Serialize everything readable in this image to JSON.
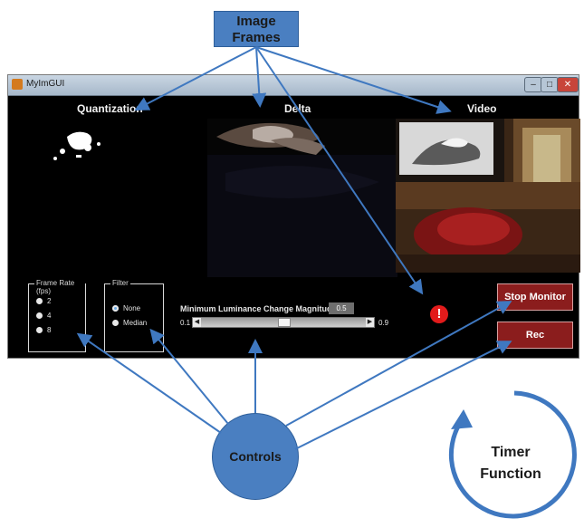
{
  "callout_image_frames": [
    "Image",
    "Frames"
  ],
  "callout_controls": "Controls",
  "callout_timer": [
    "Timer",
    "Function"
  ],
  "window": {
    "title": "MyImGUI",
    "panels": {
      "quantization": "Quantization",
      "delta": "Delta",
      "video": "Video"
    },
    "frame_rate": {
      "label": "Frame Rate (fps)",
      "options": [
        "2",
        "4",
        "8"
      ]
    },
    "filter": {
      "label": "Filter",
      "options": [
        "None",
        "Median"
      ],
      "selected": "None"
    },
    "luminance": {
      "label": "Minimum Luminance Change Magnitude",
      "value": "0.5",
      "min": "0.1",
      "max": "0.9"
    },
    "alert_symbol": "!",
    "buttons": {
      "stop_monitor": "Stop Monitor",
      "rec": "Rec"
    }
  },
  "colors": {
    "callout_fill": "#4a7fc1",
    "arrow": "#3f78c0",
    "button_fill": "#8b1d1d",
    "alert": "#e21b1b"
  }
}
